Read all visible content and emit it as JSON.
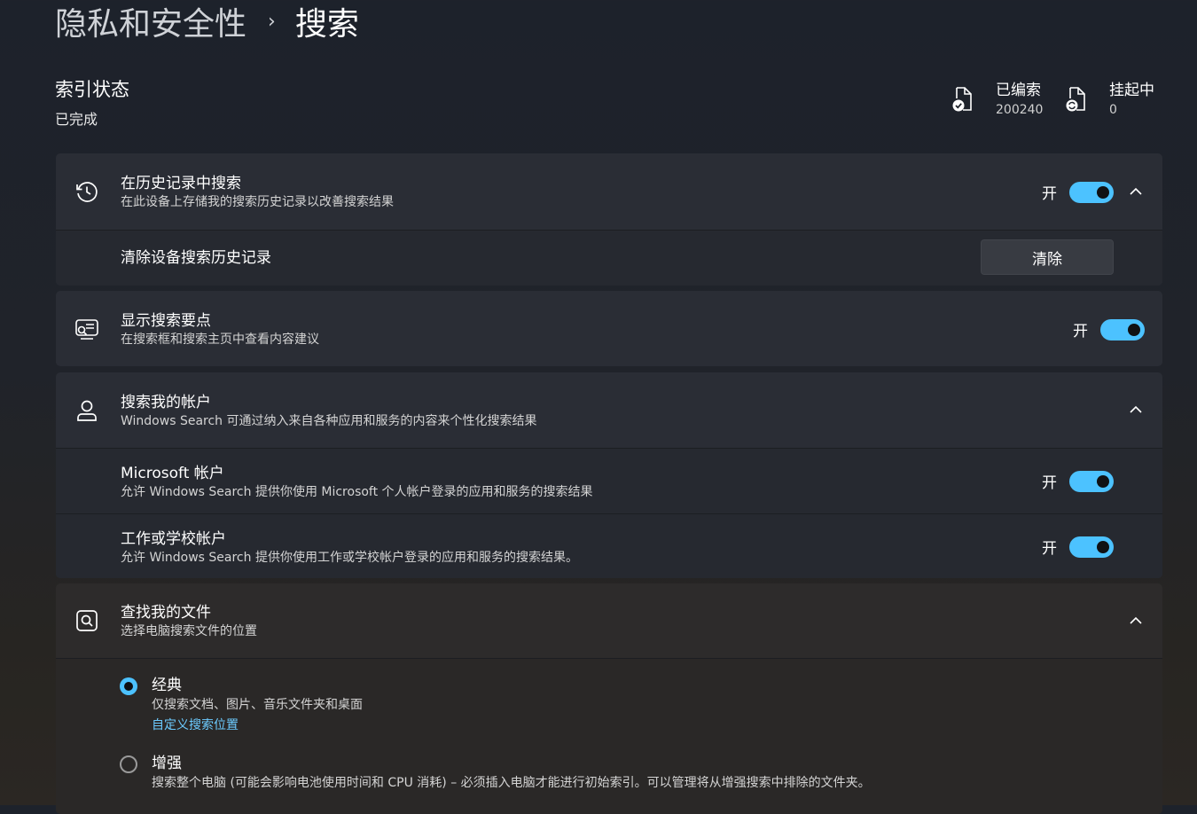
{
  "breadcrumb": {
    "parent": "隐私和安全性",
    "current": "搜索"
  },
  "index_status": {
    "title": "索引状态",
    "value": "已完成",
    "indexed_label": "已编索",
    "indexed_value": "200240",
    "pending_label": "挂起中",
    "pending_value": "0"
  },
  "history": {
    "title": "在历史记录中搜索",
    "subtitle": "在此设备上存储我的搜索历史记录以改善搜索结果",
    "toggle_label": "开",
    "clear_title": "清除设备搜索历史记录",
    "clear_button": "清除"
  },
  "highlights": {
    "title": "显示搜索要点",
    "subtitle": "在搜索框和搜索主页中查看内容建议",
    "toggle_label": "开"
  },
  "accounts": {
    "title": "搜索我的帐户",
    "subtitle": "Windows Search 可通过纳入来自各种应用和服务的内容来个性化搜索结果",
    "microsoft": {
      "title": "Microsoft 帐户",
      "subtitle": "允许 Windows Search 提供你使用 Microsoft 个人帐户登录的应用和服务的搜索结果",
      "toggle_label": "开"
    },
    "work": {
      "title": "工作或学校帐户",
      "subtitle": "允许 Windows Search 提供你使用工作或学校帐户登录的应用和服务的搜索结果。",
      "toggle_label": "开"
    }
  },
  "files": {
    "title": "查找我的文件",
    "subtitle": "选择电脑搜索文件的位置",
    "classic": {
      "title": "经典",
      "subtitle": "仅搜索文档、图片、音乐文件夹和桌面",
      "link": "自定义搜索位置"
    },
    "enhanced": {
      "title": "增强",
      "subtitle": "搜索整个电脑 (可能会影响电池使用时间和 CPU 消耗) – 必须插入电脑才能进行初始索引。可以管理将从增强搜索中排除的文件夹。"
    }
  },
  "colors": {
    "accent": "#4cc2ff",
    "link": "#6ccbff",
    "card": "#2a2d35"
  }
}
